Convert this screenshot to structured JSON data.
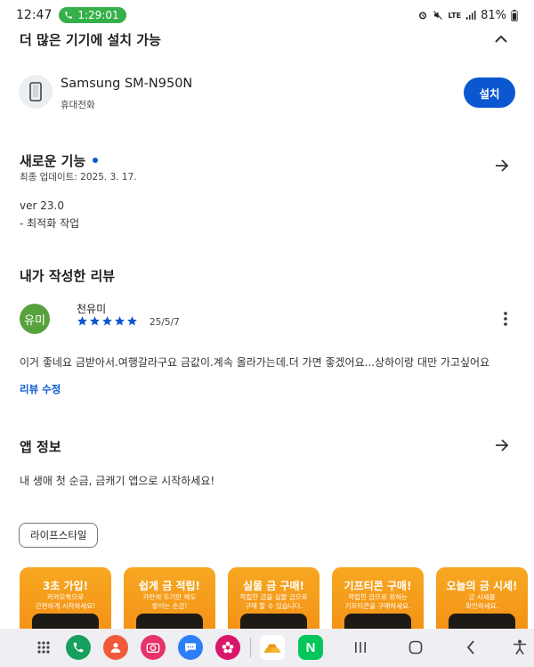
{
  "status_bar": {
    "time": "12:47",
    "call_duration": "1:29:01",
    "battery": "81%",
    "network": "LTE"
  },
  "install_section": {
    "title": "더 많은 기기에 설치 가능",
    "device_name": "Samsung SM-N950N",
    "device_type": "휴대전화",
    "install_label": "설치"
  },
  "whats_new": {
    "title": "새로운 기능",
    "updated": "최종 업데이트: 2025. 3. 17.",
    "version": "ver 23.0",
    "notes": "- 최적화 작업"
  },
  "my_review": {
    "title": "내가 작성한 리뷰",
    "avatar_text": "유미",
    "reviewer": "천유미",
    "rating": 5,
    "date": "25/5/7",
    "text": "이거 좋네요 금받아서.여행갈라구요 금값이.계속 올라가는데.더 가면 좋겠어요...상하이랑 대만 가고싶어요",
    "edit_label": "리뷰 수정"
  },
  "app_info": {
    "title": "앱 정보",
    "description": "내 생애 첫 순금, 금캐기 앱으로 시작하세요!",
    "category_chip": "라이프스타일"
  },
  "screenshots": [
    {
      "title": "3초 가입!",
      "subtitle_1": "카카오톡으로",
      "subtitle_2": "간편하게 시작하세요!"
    },
    {
      "title": "쉽게 금 적립!",
      "subtitle_1": "가만히 두기만 해도",
      "subtitle_2": "쌓이는 순금!"
    },
    {
      "title": "실물 금 구매!",
      "subtitle_1": "적립한 금을 실물 금으로",
      "subtitle_2": "구매 할 수 있습니다."
    },
    {
      "title": "기프티콘 구매!",
      "subtitle_1": "적립한 금으로 원하는",
      "subtitle_2": "기프티콘을 구매하세요."
    },
    {
      "title": "오늘의 금 시세!",
      "subtitle_1": "금 시세를",
      "subtitle_2": "확인하세요."
    }
  ],
  "colors": {
    "accent": "#0b57d0",
    "star": "#0b57d0",
    "avatar_bg": "#58a23d",
    "screenshot_bg": "#f59a1a",
    "call_pill": "#35b04a"
  },
  "nav_bar": {
    "apps": [
      "apps-grid-icon",
      "phone-app-icon",
      "contacts-app-icon",
      "camera-app-icon",
      "messages-app-icon",
      "gallery-app-icon",
      "gold-app-icon",
      "naver-app-icon"
    ],
    "naver_letter": "N"
  }
}
